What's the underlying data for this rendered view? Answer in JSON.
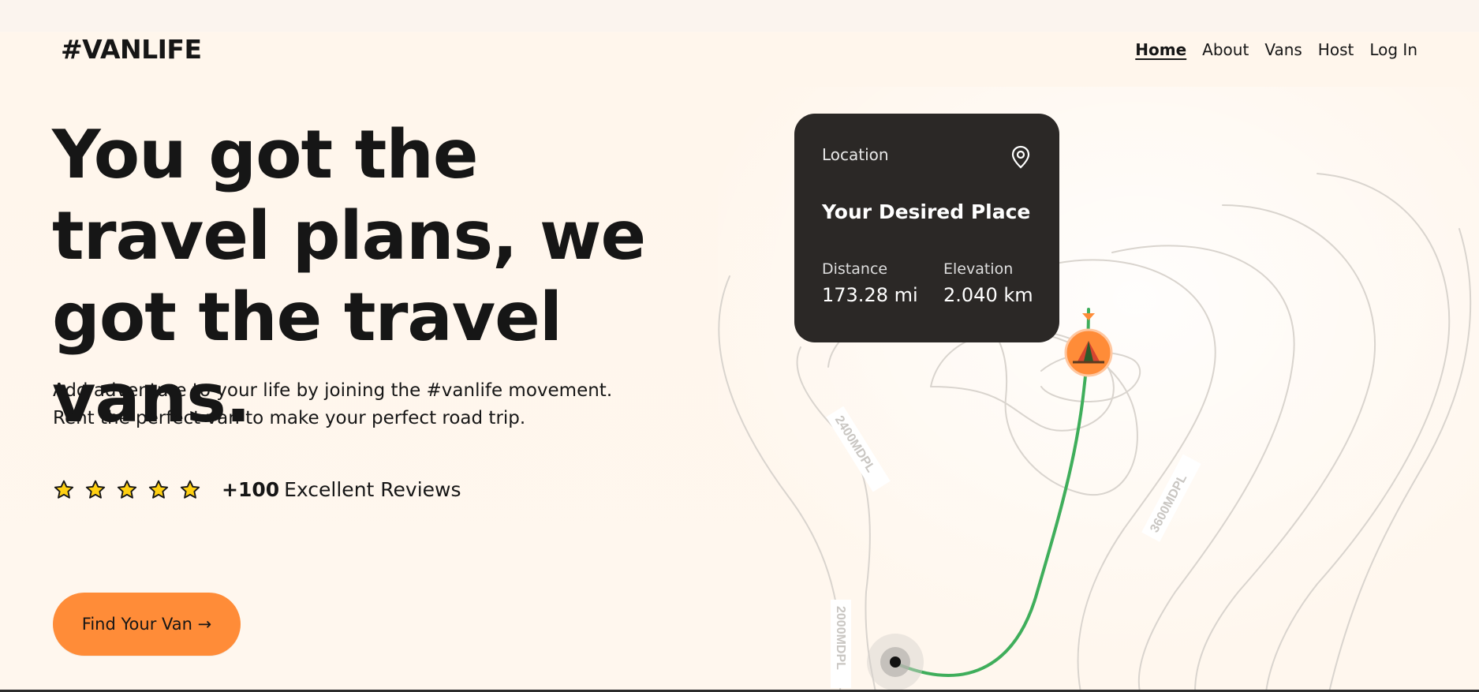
{
  "brand": {
    "logo": "#VANLIFE"
  },
  "nav": {
    "items": [
      {
        "label": "Home",
        "active": true
      },
      {
        "label": "About",
        "active": false
      },
      {
        "label": "Vans",
        "active": false
      },
      {
        "label": "Host",
        "active": false
      },
      {
        "label": "Log In",
        "active": false
      }
    ]
  },
  "hero": {
    "title": "You got the travel plans, we got the travel vans.",
    "subtitle_line1": "Add adventure to your life by joining the #vanlife movement.",
    "subtitle_line2": "Rent the perfect van to make your perfect road trip.",
    "rating_stars": 5,
    "reviews_count": "+100",
    "reviews_label": "Excellent Reviews",
    "cta_label": "Find Your Van →"
  },
  "location_card": {
    "label": "Location",
    "place": "Your Desired Place",
    "distance_label": "Distance",
    "distance_value": "173.28 mi",
    "elevation_label": "Elevation",
    "elevation_value": "2.040 km"
  },
  "map": {
    "contour_labels": [
      "2400MDPL",
      "3600MDPL",
      "2000MDPL"
    ],
    "destination_icon": "camp-tent-icon",
    "origin_icon": "location-dot-icon",
    "route_color": "#3FAE5B",
    "marker_color": "#FF8C38"
  },
  "colors": {
    "background": "#FFF7EE",
    "accent": "#FF8C38",
    "card_bg": "#2B2826",
    "star": "#FFD012",
    "text": "#161616"
  }
}
